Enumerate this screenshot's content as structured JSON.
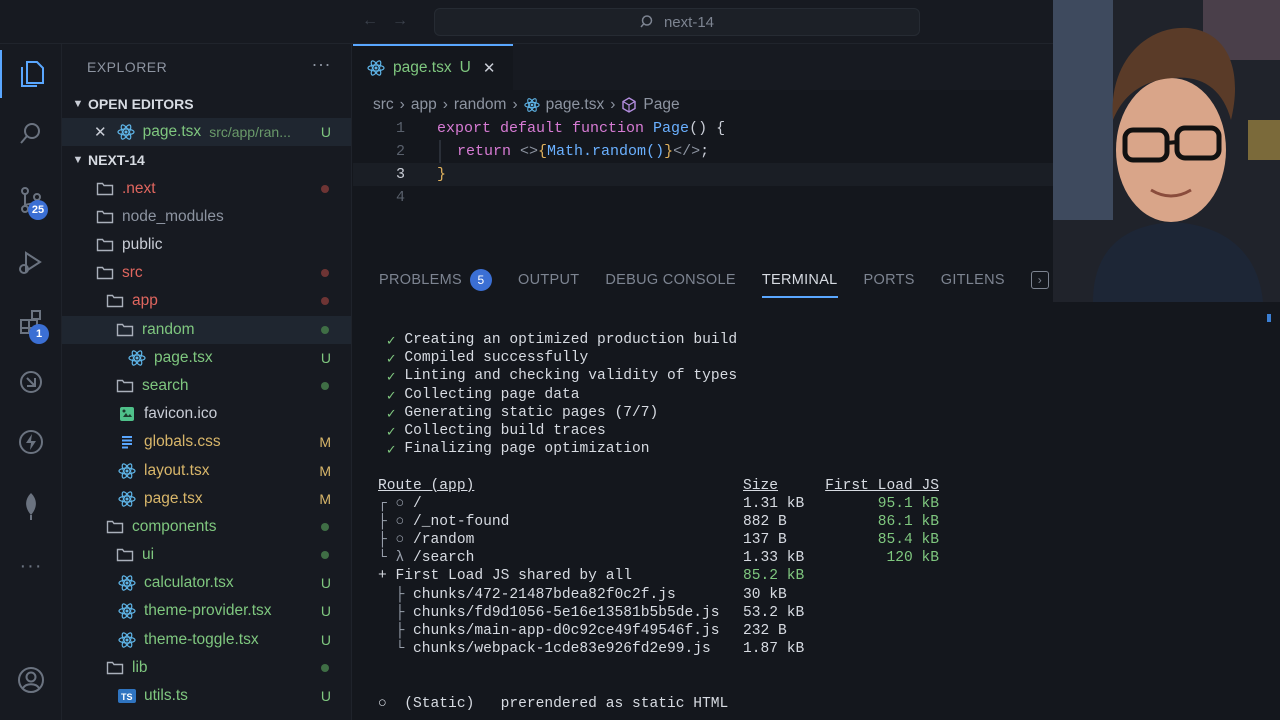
{
  "titlebar": {
    "search_text": "next-14"
  },
  "activity": {
    "scm_badge": "25",
    "extensions_badge": "1"
  },
  "sidebar": {
    "title": "EXPLORER",
    "open_editors_label": "OPEN EDITORS",
    "open_editor": {
      "name": "page.tsx",
      "path": "src/app/ran...",
      "status": "U"
    },
    "project_label": "NEXT-14",
    "tree": [
      {
        "name": ".next",
        "kind": "folder",
        "depth": 0,
        "color": "red",
        "marker": "dot-red"
      },
      {
        "name": "node_modules",
        "kind": "folder",
        "depth": 0,
        "color": "gray",
        "marker": ""
      },
      {
        "name": "public",
        "kind": "folder",
        "depth": 0,
        "color": "default",
        "marker": ""
      },
      {
        "name": "src",
        "kind": "folder",
        "depth": 0,
        "color": "red",
        "marker": "dot-red"
      },
      {
        "name": "app",
        "kind": "folder",
        "depth": 1,
        "color": "red",
        "marker": "dot-red"
      },
      {
        "name": "random",
        "kind": "folder",
        "depth": 2,
        "color": "green",
        "marker": "dot-green",
        "selected": true
      },
      {
        "name": "page.tsx",
        "kind": "react",
        "depth": 3,
        "color": "green",
        "marker": "U"
      },
      {
        "name": "search",
        "kind": "folder",
        "depth": 2,
        "color": "green",
        "marker": "dot-green"
      },
      {
        "name": "favicon.ico",
        "kind": "image",
        "depth": 2,
        "color": "default",
        "marker": ""
      },
      {
        "name": "globals.css",
        "kind": "css",
        "depth": 2,
        "color": "yellowish",
        "marker": "M"
      },
      {
        "name": "layout.tsx",
        "kind": "react",
        "depth": 2,
        "color": "yellowish",
        "marker": "M"
      },
      {
        "name": "page.tsx",
        "kind": "react",
        "depth": 2,
        "color": "yellowish",
        "marker": "M"
      },
      {
        "name": "components",
        "kind": "folder",
        "depth": 1,
        "color": "green",
        "marker": "dot-green"
      },
      {
        "name": "ui",
        "kind": "folder",
        "depth": 2,
        "color": "green",
        "marker": "dot-green"
      },
      {
        "name": "calculator.tsx",
        "kind": "react",
        "depth": 2,
        "color": "green",
        "marker": "U"
      },
      {
        "name": "theme-provider.tsx",
        "kind": "react",
        "depth": 2,
        "color": "green",
        "marker": "U"
      },
      {
        "name": "theme-toggle.tsx",
        "kind": "react",
        "depth": 2,
        "color": "green",
        "marker": "U"
      },
      {
        "name": "lib",
        "kind": "folder",
        "depth": 1,
        "color": "green",
        "marker": "dot-green"
      },
      {
        "name": "utils.ts",
        "kind": "ts",
        "depth": 2,
        "color": "green",
        "marker": "U"
      }
    ]
  },
  "editor": {
    "tab_label": "page.tsx",
    "tab_status": "U",
    "breadcrumb": [
      "src",
      "app",
      "random",
      "page.tsx",
      "Page"
    ],
    "line_numbers": [
      "1",
      "2",
      "3",
      "4"
    ],
    "code": {
      "l1_kw": "export default function ",
      "l1_fn": "Page",
      "l1_rest": "() {",
      "l2_kw": "return ",
      "l2_open": "<>",
      "l2_brace_open": "{",
      "l2_expr": "Math.random()",
      "l2_brace_close": "}",
      "l2_close": "</>",
      "l2_semi": ";",
      "l3": "}"
    }
  },
  "panel": {
    "tabs": [
      {
        "label": "PROBLEMS",
        "badge": "5"
      },
      {
        "label": "OUTPUT"
      },
      {
        "label": "DEBUG CONSOLE"
      },
      {
        "label": "TERMINAL",
        "active": true
      },
      {
        "label": "PORTS"
      },
      {
        "label": "GITLENS"
      }
    ]
  },
  "terminal": {
    "steps": [
      "Creating an optimized production build",
      "Compiled successfully",
      "Linting and checking validity of types",
      "Collecting page data",
      "Generating static pages (7/7)",
      "Collecting build traces",
      "Finalizing page optimization"
    ],
    "header": {
      "route": "Route (app)",
      "size": "Size",
      "first": "First Load JS"
    },
    "routes": [
      {
        "prefix": "┌ ○ ",
        "path": "/",
        "size": "1.31 kB",
        "first": "95.1 kB"
      },
      {
        "prefix": "├ ○ ",
        "path": "/_not-found",
        "size": "882 B",
        "first": "86.1 kB"
      },
      {
        "prefix": "├ ○ ",
        "path": "/random",
        "size": "137 B",
        "first": "85.4 kB"
      },
      {
        "prefix": "└ λ ",
        "path": "/search",
        "size": "1.33 kB",
        "first": "120 kB"
      }
    ],
    "shared": {
      "label": "+ First Load JS shared by all",
      "size": "85.2 kB"
    },
    "chunks": [
      {
        "prefix": "  ├ ",
        "name": "chunks/472-21487bdea82f0c2f.js",
        "size": "30 kB"
      },
      {
        "prefix": "  ├ ",
        "name": "chunks/fd9d1056-5e16e13581b5b5de.js",
        "size": "53.2 kB"
      },
      {
        "prefix": "  ├ ",
        "name": "chunks/main-app-d0c92ce49f49546f.js",
        "size": "232 B"
      },
      {
        "prefix": "  └ ",
        "name": "chunks/webpack-1cde83e926fd2e99.js",
        "size": "1.87 kB"
      }
    ],
    "legend_static": "○  (Static)   prerendered as static HTML"
  }
}
